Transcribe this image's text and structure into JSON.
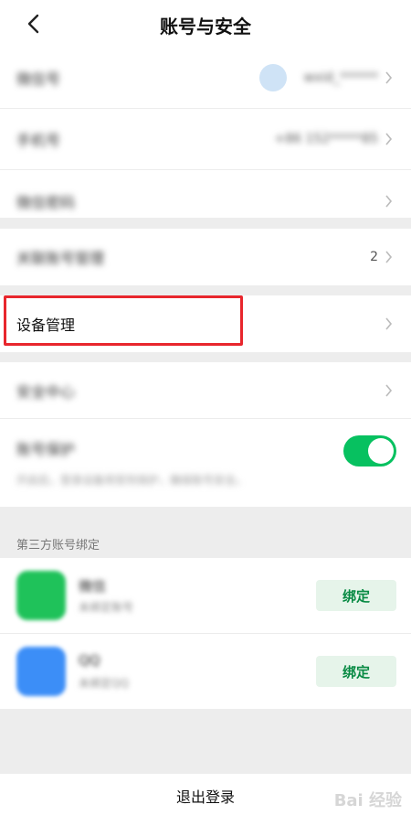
{
  "header": {
    "title": "账号与安全"
  },
  "account": {
    "wechat_id_label": "微信号",
    "wechat_id_value": "wxid_******",
    "phone_label": "手机号",
    "phone_value": "+86 152*****85",
    "password_label": "微信密码"
  },
  "linked": {
    "label": "关联账号管理",
    "count": "2"
  },
  "device": {
    "label": "设备管理"
  },
  "security": {
    "center_label": "安全中心",
    "protect_label": "账号保护",
    "protect_desc": "开启后，登录设备将受到保护，确保账号安全。",
    "protect_on": true
  },
  "third_party": {
    "section_title": "第三方账号绑定",
    "items": [
      {
        "name": "微信",
        "sub": "未绑定账号",
        "button": "绑定",
        "icon": "wechat-icon",
        "color": "#1fc25a"
      },
      {
        "name": "QQ",
        "sub": "未绑定QQ",
        "button": "绑定",
        "icon": "qq-icon",
        "color": "#3c8ef7"
      }
    ]
  },
  "footer": {
    "logout": "退出登录"
  },
  "watermark": "Bai 经验"
}
